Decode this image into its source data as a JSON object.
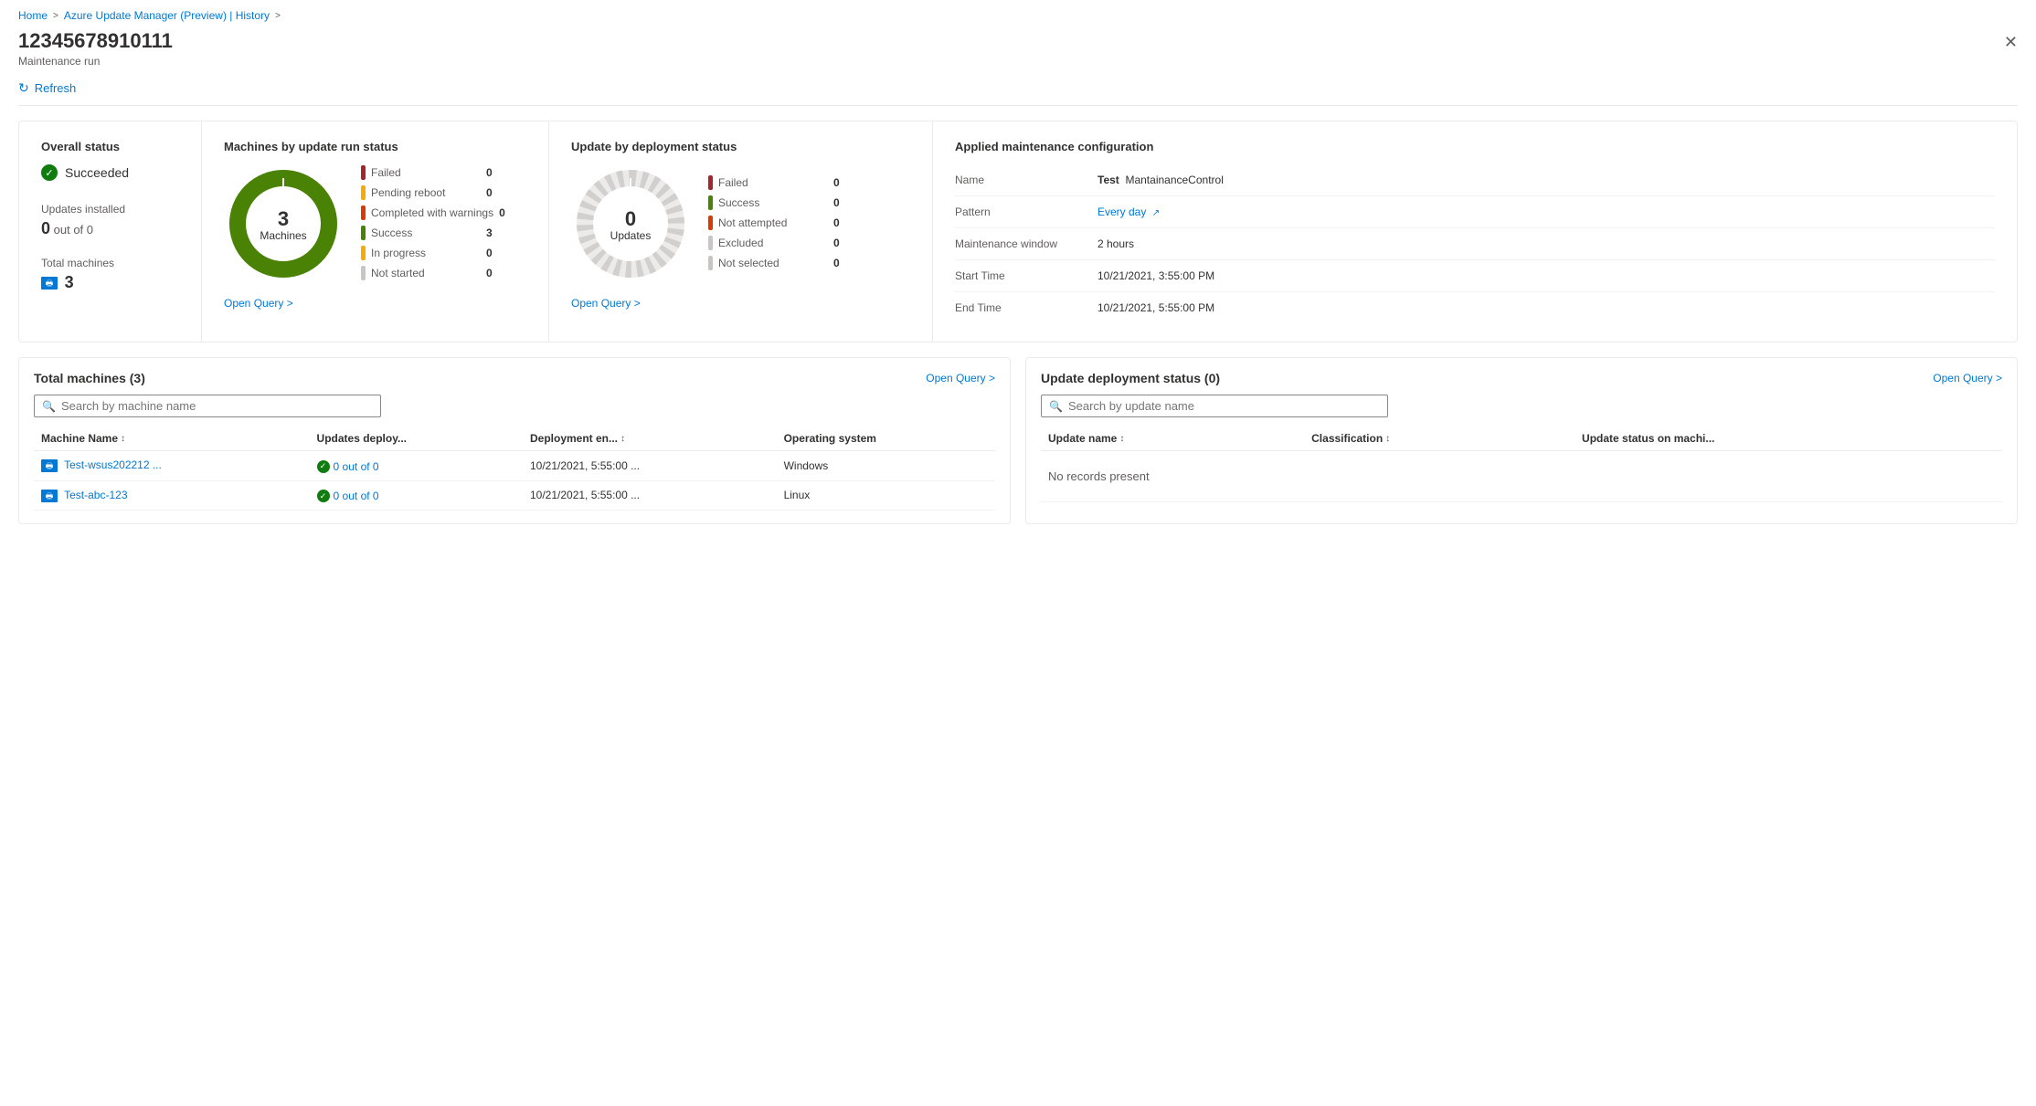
{
  "breadcrumb": {
    "home": "Home",
    "parent": "Azure Update Manager (Preview) | History",
    "sep": ">"
  },
  "header": {
    "title": "12345678910111",
    "subtitle": "Maintenance run"
  },
  "toolbar": {
    "refresh_label": "Refresh"
  },
  "overall_status": {
    "panel_title": "Overall status",
    "status": "Succeeded",
    "updates_installed_label": "Updates installed",
    "updates_installed_value": "0",
    "updates_installed_suffix": "out of 0",
    "total_machines_label": "Total machines",
    "total_machines_value": "3"
  },
  "machines_chart": {
    "panel_title": "Machines by update run status",
    "donut_center_num": "3",
    "donut_center_text": "Machines",
    "legend": [
      {
        "label": "Failed",
        "value": "0",
        "color": "#a4262c"
      },
      {
        "label": "Pending reboot",
        "value": "0",
        "color": "#f7aa00"
      },
      {
        "label": "Completed with warnings",
        "value": "0",
        "color": "#d83b01"
      },
      {
        "label": "Success",
        "value": "3",
        "color": "#498205"
      },
      {
        "label": "In progress",
        "value": "0",
        "color": "#f7aa00"
      },
      {
        "label": "Not started",
        "value": "0",
        "color": "#c8c6c4"
      }
    ],
    "open_query": "Open Query >"
  },
  "updates_chart": {
    "panel_title": "Update by deployment status",
    "donut_center_num": "0",
    "donut_center_text": "Updates",
    "legend": [
      {
        "label": "Failed",
        "value": "0",
        "color": "#a4262c"
      },
      {
        "label": "Success",
        "value": "0",
        "color": "#498205"
      },
      {
        "label": "Not attempted",
        "value": "0",
        "color": "#d83b01"
      },
      {
        "label": "Excluded",
        "value": "0",
        "color": "#c8c6c4"
      },
      {
        "label": "Not selected",
        "value": "0",
        "color": "#c8c6c4"
      }
    ],
    "open_query": "Open Query >"
  },
  "maintenance_config": {
    "panel_title": "Applied maintenance configuration",
    "rows": [
      {
        "key": "Name",
        "value": "Test  MantainanceControl",
        "type": "text"
      },
      {
        "key": "Pattern",
        "value": "Every day",
        "type": "link"
      },
      {
        "key": "Maintenance window",
        "value": "2 hours",
        "type": "text"
      },
      {
        "key": "Start Time",
        "value": "10/21/2021, 3:55:00 PM",
        "type": "text"
      },
      {
        "key": "End Time",
        "value": "10/21/2021, 5:55:00 PM",
        "type": "text"
      }
    ]
  },
  "machines_table": {
    "title": "Total machines (3)",
    "open_query": "Open Query >",
    "search_placeholder": "Search by machine name",
    "columns": [
      {
        "label": "Machine Name",
        "sortable": true
      },
      {
        "label": "Updates deploy...",
        "sortable": false
      },
      {
        "label": "Deployment en...",
        "sortable": true
      },
      {
        "label": "Operating system",
        "sortable": false
      }
    ],
    "rows": [
      {
        "name": "Test-wsus202212 ...",
        "updates": "0 out of 0",
        "deployment_end": "10/21/2021, 5:55:00 ...",
        "os": "Windows",
        "status": "success"
      },
      {
        "name": "Test-abc-123",
        "updates": "0 out of 0",
        "deployment_end": "10/21/2021, 5:55:00 ...",
        "os": "Linux",
        "status": "success"
      }
    ]
  },
  "updates_table": {
    "title": "Update deployment status (0)",
    "open_query": "Open Query >",
    "search_placeholder": "Search by update name",
    "columns": [
      {
        "label": "Update name",
        "sortable": true
      },
      {
        "label": "Classification",
        "sortable": true
      },
      {
        "label": "Update status on machi...",
        "sortable": false
      }
    ],
    "no_records": "No records present"
  }
}
